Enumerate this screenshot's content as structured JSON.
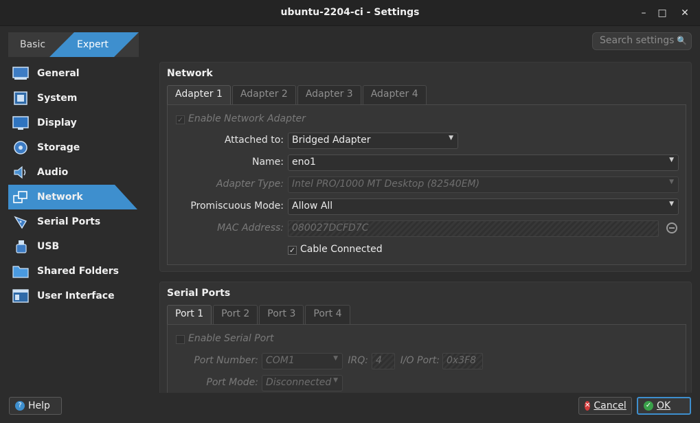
{
  "window": {
    "title": "ubuntu-2204-ci - Settings"
  },
  "mode": {
    "basic": "Basic",
    "expert": "Expert"
  },
  "search": {
    "placeholder": "Search settings"
  },
  "nav": [
    {
      "label": "General",
      "icon": "general-icon",
      "active": false
    },
    {
      "label": "System",
      "icon": "system-icon",
      "active": false
    },
    {
      "label": "Display",
      "icon": "display-icon",
      "active": false
    },
    {
      "label": "Storage",
      "icon": "storage-icon",
      "active": false
    },
    {
      "label": "Audio",
      "icon": "audio-icon",
      "active": false
    },
    {
      "label": "Network",
      "icon": "network-icon",
      "active": true
    },
    {
      "label": "Serial Ports",
      "icon": "serial-ports-icon",
      "active": false
    },
    {
      "label": "USB",
      "icon": "usb-icon",
      "active": false
    },
    {
      "label": "Shared Folders",
      "icon": "shared-folders-icon",
      "active": false
    },
    {
      "label": "User Interface",
      "icon": "user-interface-icon",
      "active": false
    }
  ],
  "network": {
    "title": "Network",
    "tabs": [
      "Adapter 1",
      "Adapter 2",
      "Adapter 3",
      "Adapter 4"
    ],
    "enable_label": "Enable Network Adapter",
    "attached_label": "Attached to:",
    "attached_value": "Bridged Adapter",
    "name_label": "Name:",
    "name_value": "eno1",
    "adapter_type_label": "Adapter Type:",
    "adapter_type_value": "Intel PRO/1000 MT Desktop (82540EM)",
    "promiscuous_label": "Promiscuous Mode:",
    "promiscuous_value": "Allow All",
    "mac_label": "MAC Address:",
    "mac_value": "080027DCFD7C",
    "cable_label": "Cable Connected"
  },
  "serial": {
    "title": "Serial Ports",
    "tabs": [
      "Port 1",
      "Port 2",
      "Port 3",
      "Port 4"
    ],
    "enable_label": "Enable Serial Port",
    "port_number_label": "Port Number:",
    "port_number_value": "COM1",
    "irq_label": "IRQ:",
    "irq_value": "4",
    "io_port_label": "I/O Port:",
    "io_port_value": "0x3F8",
    "port_mode_label": "Port Mode:",
    "port_mode_value": "Disconnected"
  },
  "footer": {
    "help": "Help",
    "cancel": "Cancel",
    "ok": "OK"
  },
  "colors": {
    "accent": "#3e8fce",
    "background": "#2c2c2c"
  }
}
